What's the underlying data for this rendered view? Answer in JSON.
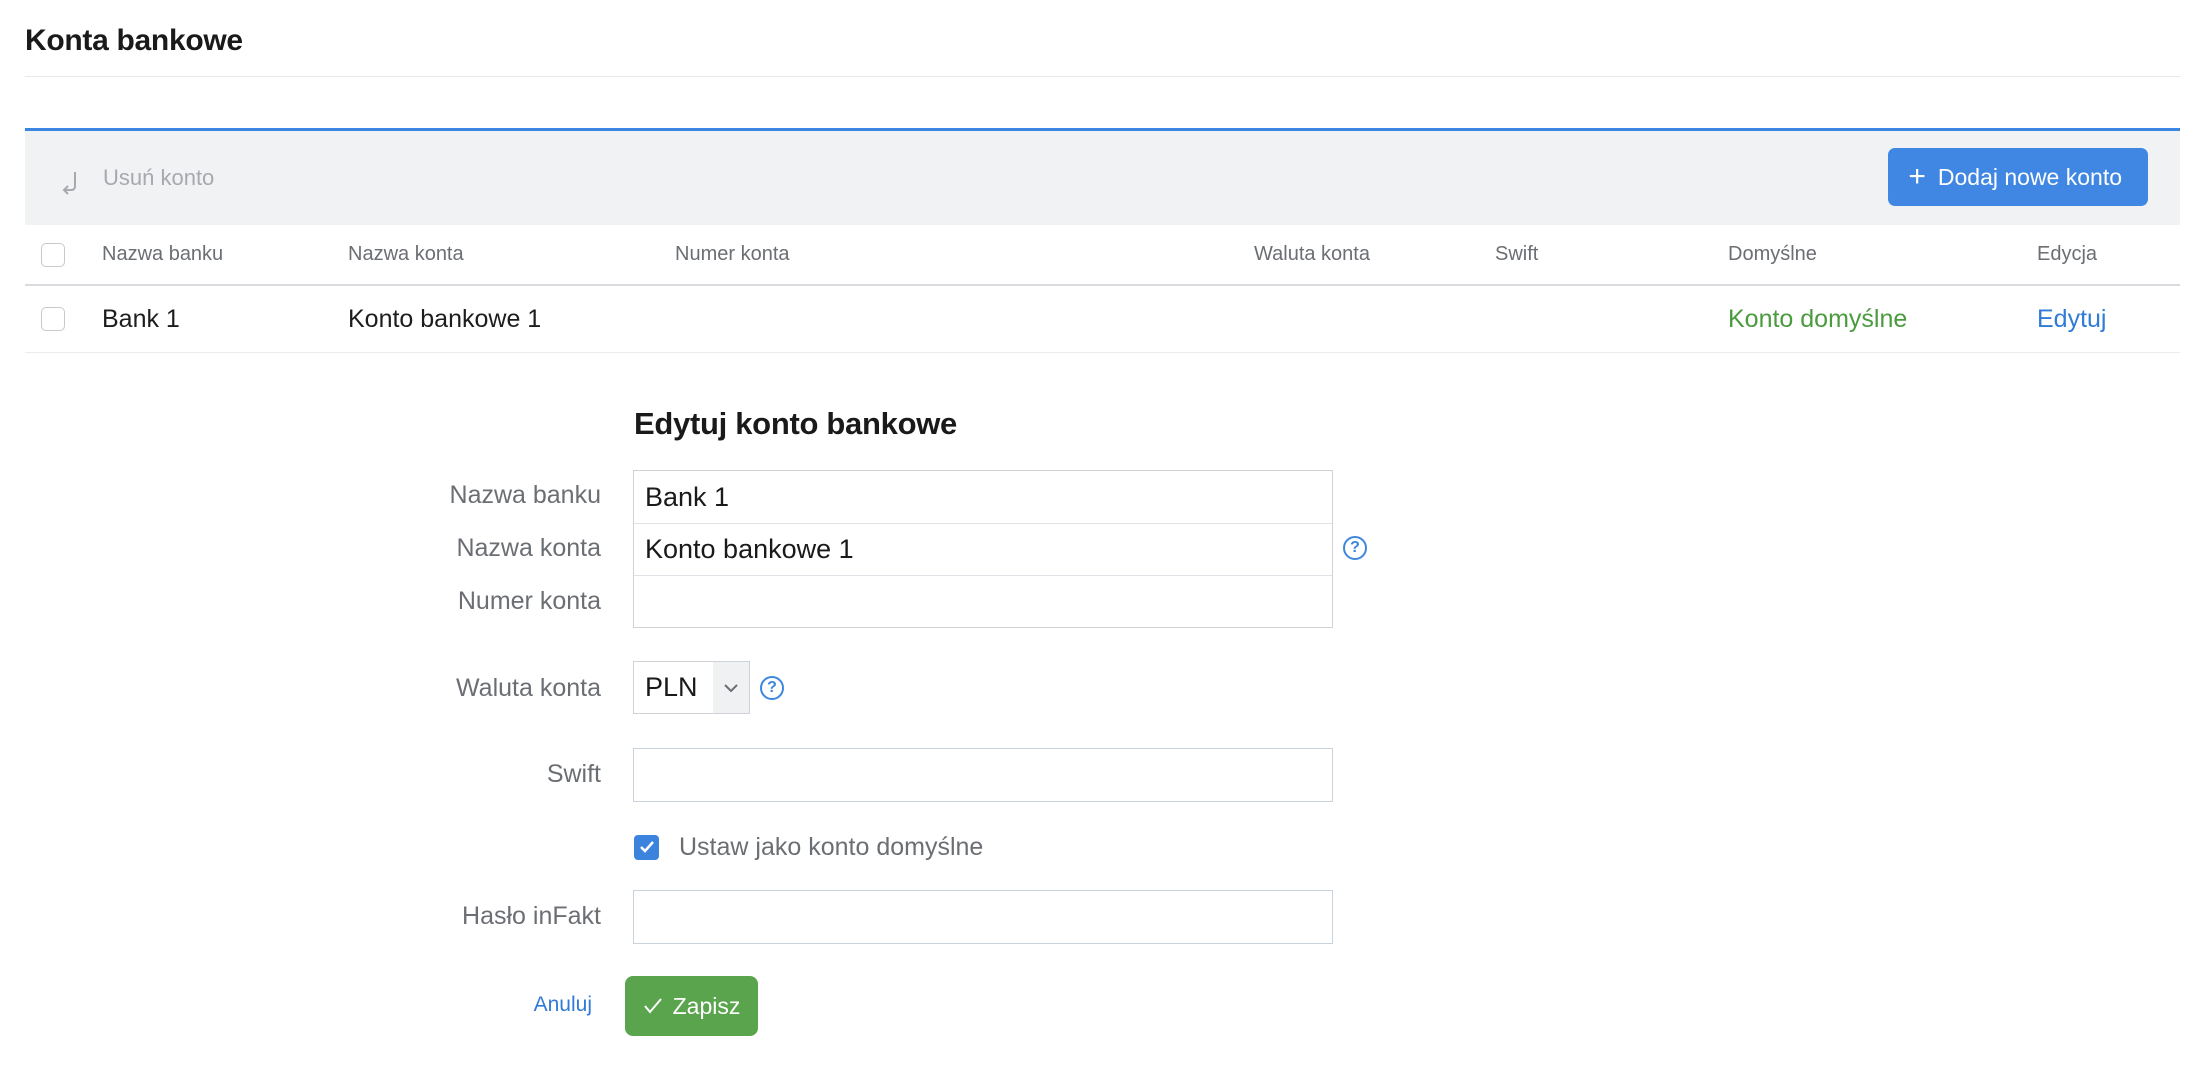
{
  "page": {
    "title": "Konta bankowe"
  },
  "toolbar": {
    "delete_label": "Usuń konto",
    "delete_icon": "arrow-return-icon",
    "add_label": "Dodaj nowe konto",
    "add_icon": "plus-icon"
  },
  "table": {
    "headers": {
      "bank_name": "Nazwa banku",
      "account_name": "Nazwa konta",
      "account_number": "Numer konta",
      "currency": "Waluta konta",
      "swift": "Swift",
      "default": "Domyślne",
      "edit": "Edycja"
    },
    "rows": [
      {
        "bank_name": "Bank 1",
        "account_name": "Konto bankowe 1",
        "account_number": "",
        "currency": "",
        "swift": "",
        "default": "Konto domyślne",
        "edit": "Edytuj"
      }
    ]
  },
  "form": {
    "title": "Edytuj konto bankowe",
    "bank_name_label": "Nazwa banku",
    "bank_name_value": "Bank 1",
    "account_name_label": "Nazwa konta",
    "account_name_value": "Konto bankowe 1",
    "account_number_label": "Numer konta",
    "account_number_value": "",
    "currency_label": "Waluta konta",
    "currency_value": "PLN",
    "swift_label": "Swift",
    "swift_value": "",
    "default_checkbox_label": "Ustaw jako konto domyślne",
    "default_checked": true,
    "password_label": "Hasło inFakt",
    "password_value": "",
    "help_icon_glyph": "?",
    "cancel_label": "Anuluj",
    "save_label": "Zapisz"
  },
  "colors": {
    "accent_blue": "#3f87e3",
    "save_green": "#5aa44e",
    "default_green": "#4a9a3e",
    "link_blue": "#2f7bd8",
    "toolbar_bg": "#f1f2f4"
  }
}
